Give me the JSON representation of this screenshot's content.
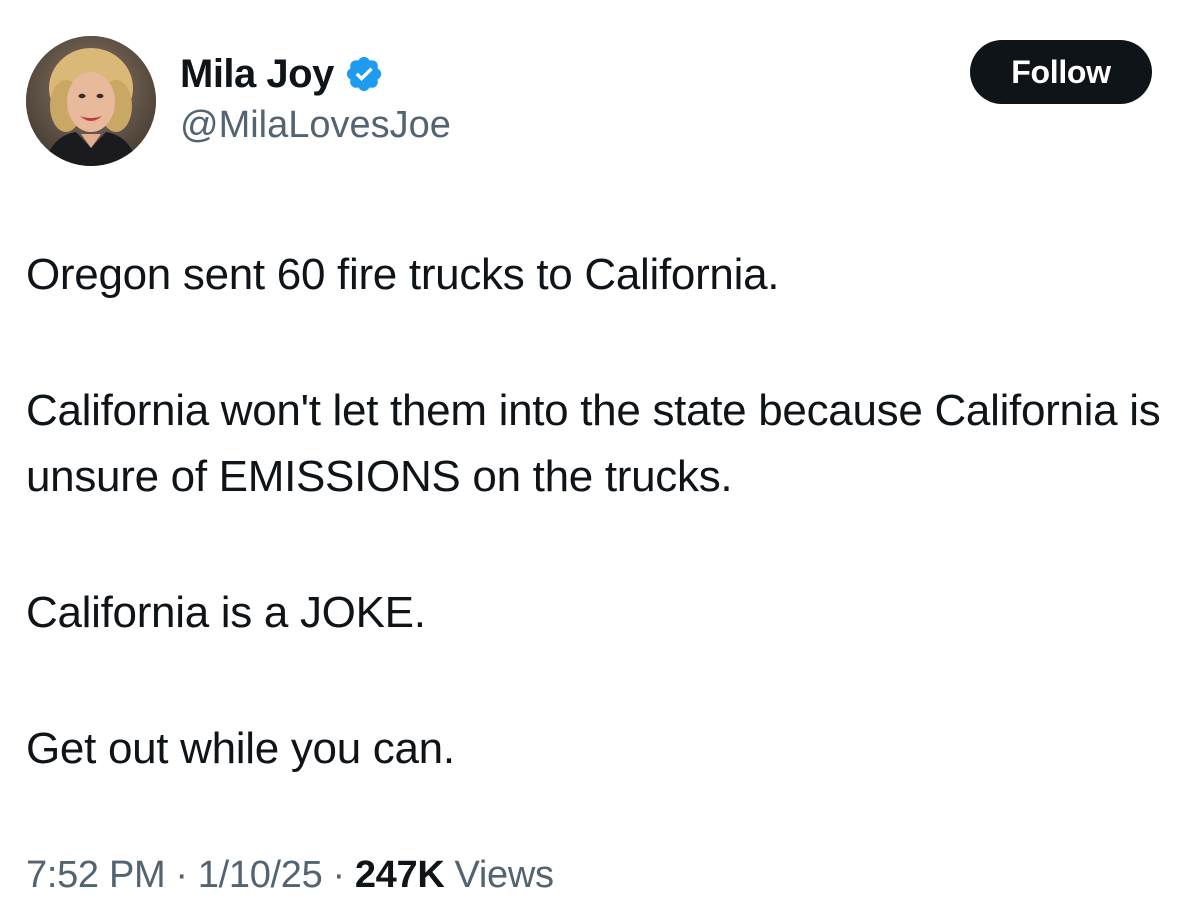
{
  "author": {
    "display_name": "Mila Joy",
    "handle": "@MilaLovesJoe",
    "verified": true,
    "avatar_icon": "profile-photo",
    "verified_icon": "verified-badge-icon",
    "verified_color": "#1d9bf0"
  },
  "follow_button": {
    "label": "Follow"
  },
  "tweet": {
    "paragraphs": [
      "Oregon sent 60 fire trucks to California.",
      "California won't let them into the state because California is unsure of EMISSIONS on the trucks.",
      "California is a JOKE.",
      "Get out while you can."
    ]
  },
  "meta": {
    "time": "7:52 PM",
    "separator": "·",
    "date": "1/10/25",
    "views_count": "247K",
    "views_label": "Views"
  },
  "colors": {
    "text_primary": "#0f1419",
    "text_secondary": "#536471",
    "button_bg": "#0f1419",
    "button_text": "#ffffff"
  }
}
